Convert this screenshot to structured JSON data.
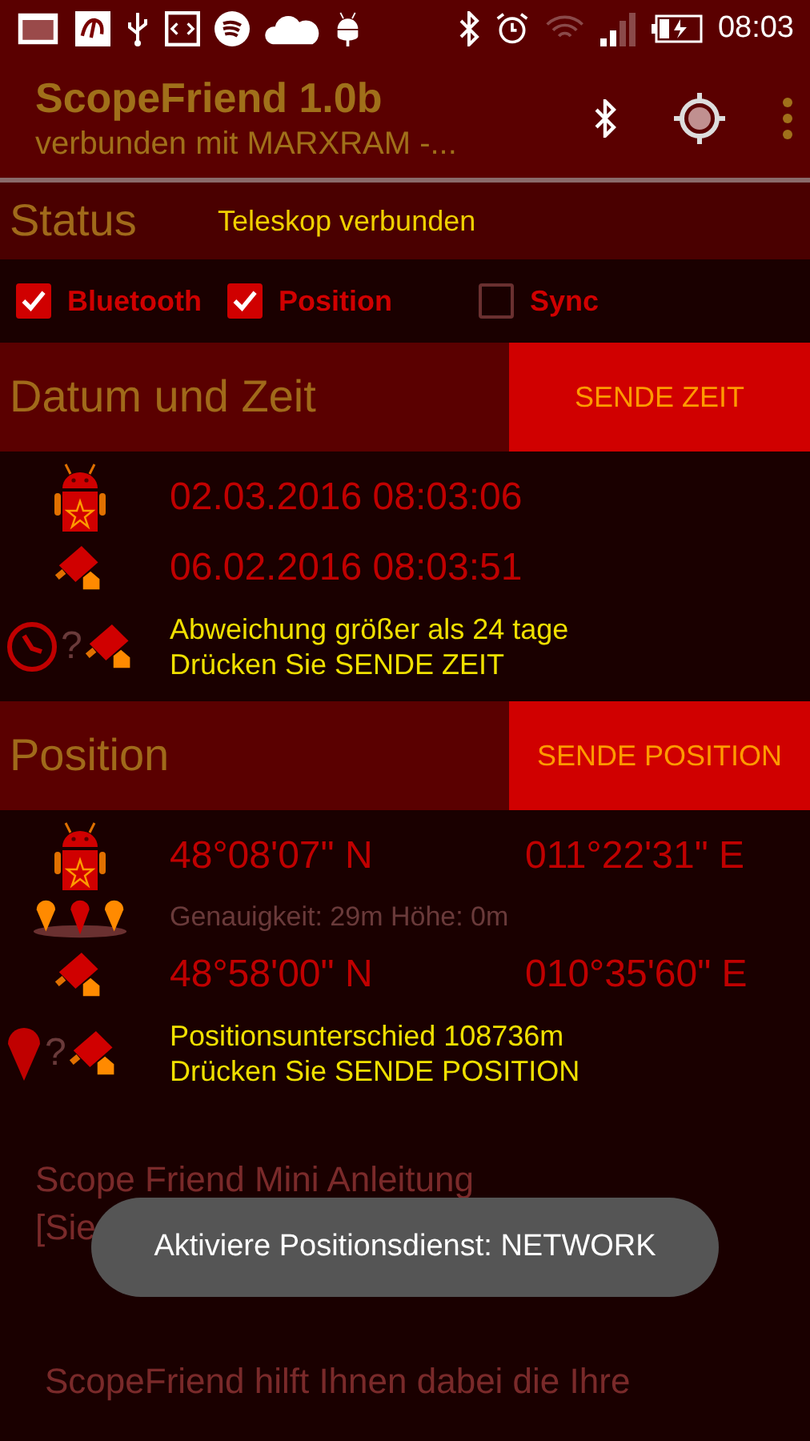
{
  "status_bar": {
    "time": "08:03"
  },
  "app_bar": {
    "title": "ScopeFriend 1.0b",
    "subtitle": "verbunden mit MARXRAM -..."
  },
  "status": {
    "label": "Status",
    "value": "Teleskop verbunden"
  },
  "toggles": [
    {
      "label": "Bluetooth",
      "checked": true
    },
    {
      "label": "Position",
      "checked": true
    },
    {
      "label": "Sync",
      "checked": false
    }
  ],
  "time_section": {
    "title": "Datum und Zeit",
    "button": "SENDE ZEIT",
    "phone_time": "02.03.2016 08:03:06",
    "scope_time": "06.02.2016 08:03:51",
    "mismatch_mark": "?",
    "warning": [
      "Abweichung größer als 24 tage",
      "Drücken Sie SENDE ZEIT"
    ]
  },
  "position_section": {
    "title": "Position",
    "button": "SENDE POSITION",
    "phone": {
      "lat": "48°08'07\" N",
      "lon": "011°22'31\" E"
    },
    "accuracy": "Genauigkeit: 29m  Höhe: 0m",
    "scope": {
      "lat": "48°58'00\" N",
      "lon": "010°35'60\" E"
    },
    "mismatch_mark": "?",
    "warning": [
      "Positionsunterschied 108736m",
      "Drücken Sie SENDE POSITION"
    ]
  },
  "manual": {
    "lines": [
      "Scope Friend Mini Anleitung",
      "[Sie"
    ],
    "intro": "ScopeFriend hilft Ihnen dabei die Ihre"
  },
  "toast": "Aktiviere Positionsdienst: NETWORK"
}
